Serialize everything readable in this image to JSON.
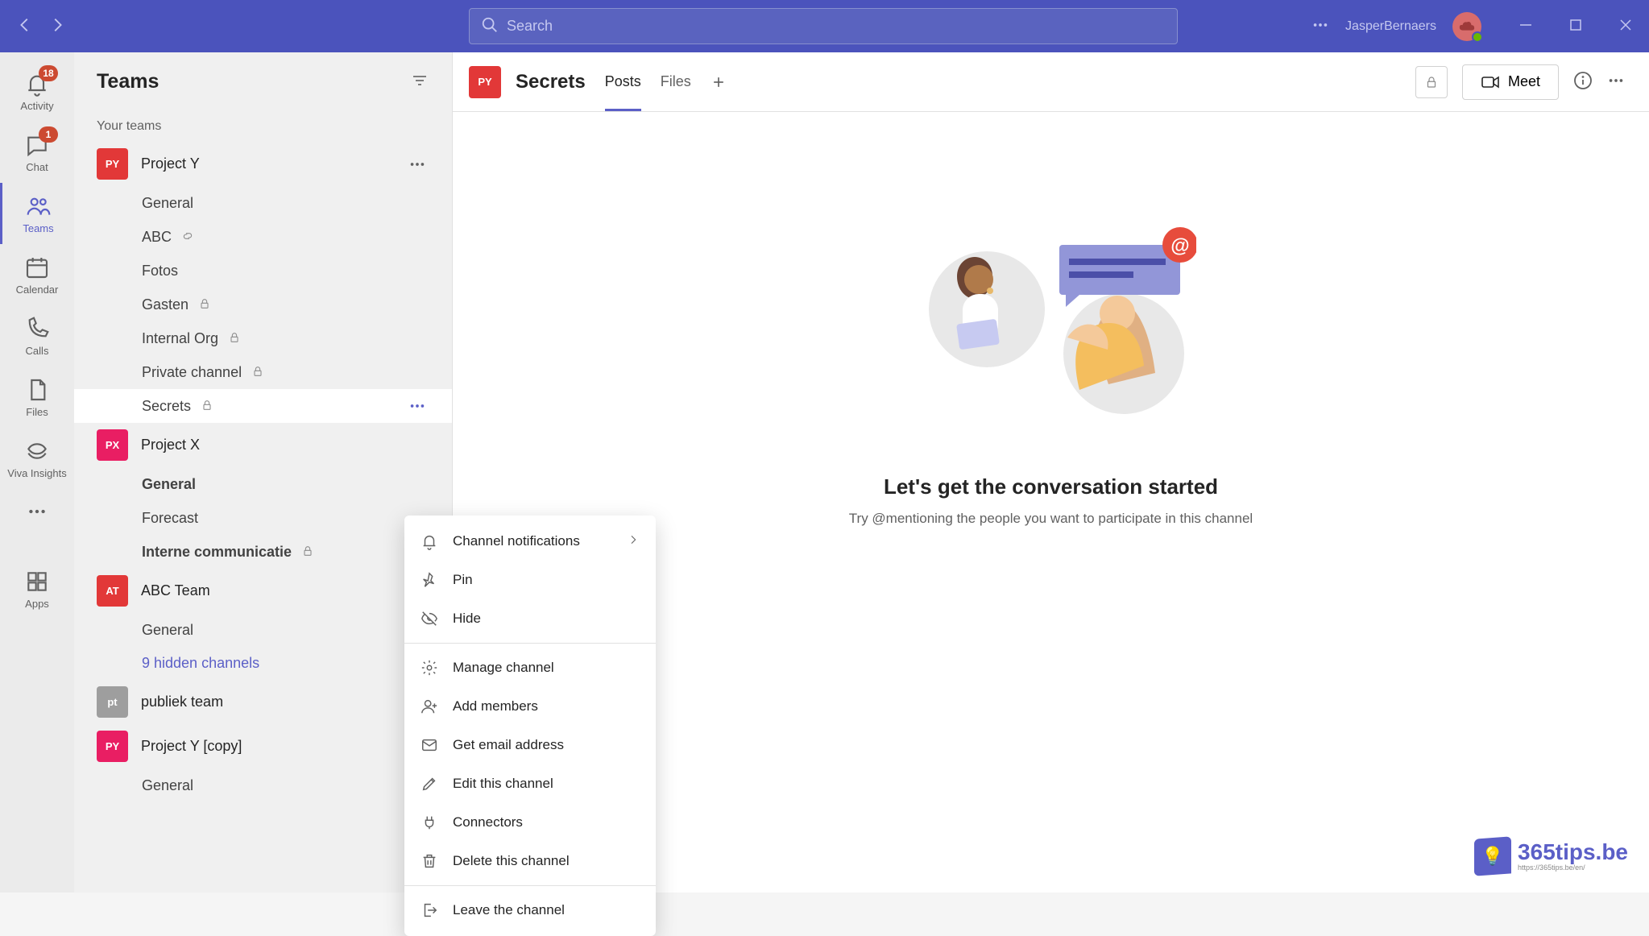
{
  "titlebar": {
    "search_placeholder": "Search",
    "username": "JasperBernaers"
  },
  "rail": {
    "activity": {
      "label": "Activity",
      "badge": "18"
    },
    "chat": {
      "label": "Chat",
      "badge": "1"
    },
    "teams": {
      "label": "Teams"
    },
    "calendar": {
      "label": "Calendar"
    },
    "calls": {
      "label": "Calls"
    },
    "files": {
      "label": "Files"
    },
    "viva": {
      "label": "Viva Insights"
    },
    "apps": {
      "label": "Apps"
    }
  },
  "sidebar": {
    "title": "Teams",
    "section": "Your teams",
    "teams": [
      {
        "name": "Project Y",
        "tile": "PY",
        "tile_class": "py",
        "channels": [
          {
            "name": "General"
          },
          {
            "name": "ABC",
            "shared": true
          },
          {
            "name": "Fotos"
          },
          {
            "name": "Gasten",
            "lock": true
          },
          {
            "name": "Internal Org",
            "lock": true
          },
          {
            "name": "Private channel",
            "lock": true
          },
          {
            "name": "Secrets",
            "lock": true,
            "active": true,
            "more": true
          }
        ]
      },
      {
        "name": "Project X",
        "tile": "PX",
        "tile_class": "px",
        "channels": [
          {
            "name": "General",
            "bold": true
          },
          {
            "name": "Forecast"
          },
          {
            "name": "Interne communicatie",
            "bold": true,
            "lock": true
          }
        ]
      },
      {
        "name": "ABC Team",
        "tile": "AT",
        "tile_class": "at",
        "channels": [
          {
            "name": "General"
          }
        ],
        "hidden_link": "9 hidden channels"
      },
      {
        "name": "publiek team",
        "tile": "pt",
        "tile_class": "pt",
        "channels": []
      },
      {
        "name": "Project Y [copy]",
        "tile": "PY",
        "tile_class": "pyc",
        "channels": [
          {
            "name": "General"
          }
        ]
      }
    ]
  },
  "context_menu": {
    "items_a": [
      {
        "icon": "bell",
        "label": "Channel notifications",
        "chevron": true
      },
      {
        "icon": "pin",
        "label": "Pin"
      },
      {
        "icon": "eye-off",
        "label": "Hide"
      }
    ],
    "items_b": [
      {
        "icon": "gear",
        "label": "Manage channel"
      },
      {
        "icon": "person-add",
        "label": "Add members"
      },
      {
        "icon": "mail",
        "label": "Get email address"
      },
      {
        "icon": "pencil",
        "label": "Edit this channel"
      },
      {
        "icon": "plug",
        "label": "Connectors"
      },
      {
        "icon": "trash",
        "label": "Delete this channel"
      }
    ],
    "items_c": [
      {
        "icon": "exit",
        "label": "Leave the channel"
      }
    ]
  },
  "main": {
    "tile": "PY",
    "title": "Secrets",
    "tabs": {
      "posts": "Posts",
      "files": "Files"
    },
    "meet_label": "Meet",
    "empty": {
      "heading": "Let's get the conversation started",
      "sub": "Try @mentioning the people you want to participate in this channel"
    }
  },
  "watermark": {
    "brand": "365tips.be",
    "sub": "https://365tips.be/en/"
  }
}
